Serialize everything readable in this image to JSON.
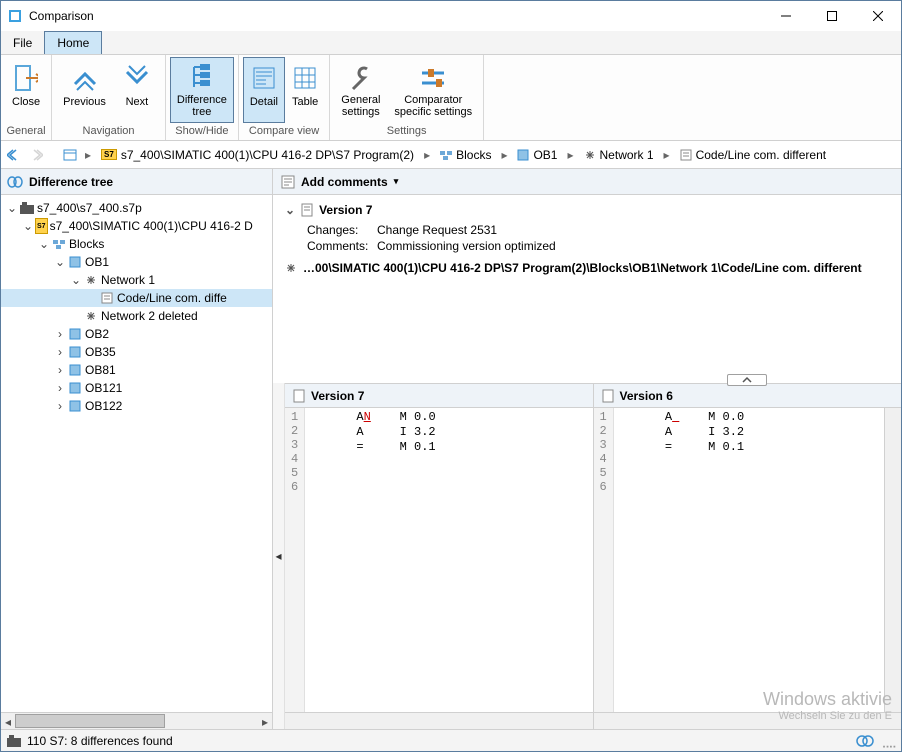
{
  "window": {
    "title": "Comparison"
  },
  "menu": {
    "file": "File",
    "home": "Home"
  },
  "ribbon": {
    "close": "Close",
    "previous": "Previous",
    "next": "Next",
    "difference_tree": "Difference\ntree",
    "detail": "Detail",
    "table": "Table",
    "general_settings": "General\nsettings",
    "comparator_settings": "Comparator\nspecific settings",
    "group_general": "General",
    "group_navigation": "Navigation",
    "group_showhide": "Show/Hide",
    "group_compareview": "Compare view",
    "group_settings": "Settings"
  },
  "breadcrumb": {
    "items": [
      {
        "icon": "s7",
        "label": "s7_400\\SIMATIC 400(1)\\CPU 416-2 DP\\S7 Program(2)"
      },
      {
        "icon": "blocks",
        "label": "Blocks"
      },
      {
        "icon": "block",
        "label": "OB1"
      },
      {
        "icon": "network",
        "label": "Network 1"
      },
      {
        "icon": "code",
        "label": "Code/Line com. different"
      }
    ]
  },
  "left_pane": {
    "title": "Difference tree",
    "tree": {
      "root": "s7_400\\s7_400.s7p",
      "proj": "s7_400\\SIMATIC 400(1)\\CPU 416-2 D",
      "blocks": "Blocks",
      "ob1": "OB1",
      "net1": "Network 1",
      "codeline": "Code/Line com. diffe",
      "net2del": "Network 2 deleted",
      "ob2": "OB2",
      "ob35": "OB35",
      "ob81": "OB81",
      "ob121": "OB121",
      "ob122": "OB122"
    }
  },
  "comments": {
    "add": "Add comments",
    "version_heading": "Version 7",
    "changes_k": "Changes:",
    "changes_v": "Change Request 2531",
    "comments_k": "Comments:",
    "comments_v": "Commissioning version optimized",
    "path": "…00\\SIMATIC 400(1)\\CPU 416-2 DP\\S7 Program(2)\\Blocks\\OB1\\Network 1\\Code/Line com. different"
  },
  "compare": {
    "left_title": "Version 7",
    "right_title": "Version 6",
    "left_lines": [
      {
        "n": "1",
        "pre": "      A",
        "diff": "N",
        "post": "    M 0.0"
      },
      {
        "n": "2",
        "pre": "      A     I 3.2",
        "diff": "",
        "post": ""
      },
      {
        "n": "3",
        "pre": "      =     M 0.1",
        "diff": "",
        "post": ""
      },
      {
        "n": "4",
        "pre": "",
        "diff": "",
        "post": ""
      },
      {
        "n": "5",
        "pre": "",
        "diff": "",
        "post": ""
      },
      {
        "n": "6",
        "pre": "",
        "diff": "",
        "post": ""
      }
    ],
    "right_lines": [
      {
        "n": "1",
        "pre": "      A",
        "diff": " ",
        "post": "    M 0.0"
      },
      {
        "n": "2",
        "pre": "      A     I 3.2",
        "diff": "",
        "post": ""
      },
      {
        "n": "3",
        "pre": "      =     M 0.1",
        "diff": "",
        "post": ""
      },
      {
        "n": "4",
        "pre": "",
        "diff": "",
        "post": ""
      },
      {
        "n": "5",
        "pre": "",
        "diff": "",
        "post": ""
      },
      {
        "n": "6",
        "pre": "",
        "diff": "",
        "post": ""
      }
    ]
  },
  "status": {
    "text": "110 S7: 8 differences found"
  },
  "watermark": {
    "line1": "Windows aktivie",
    "line2": "Wechseln Sie zu den E"
  }
}
